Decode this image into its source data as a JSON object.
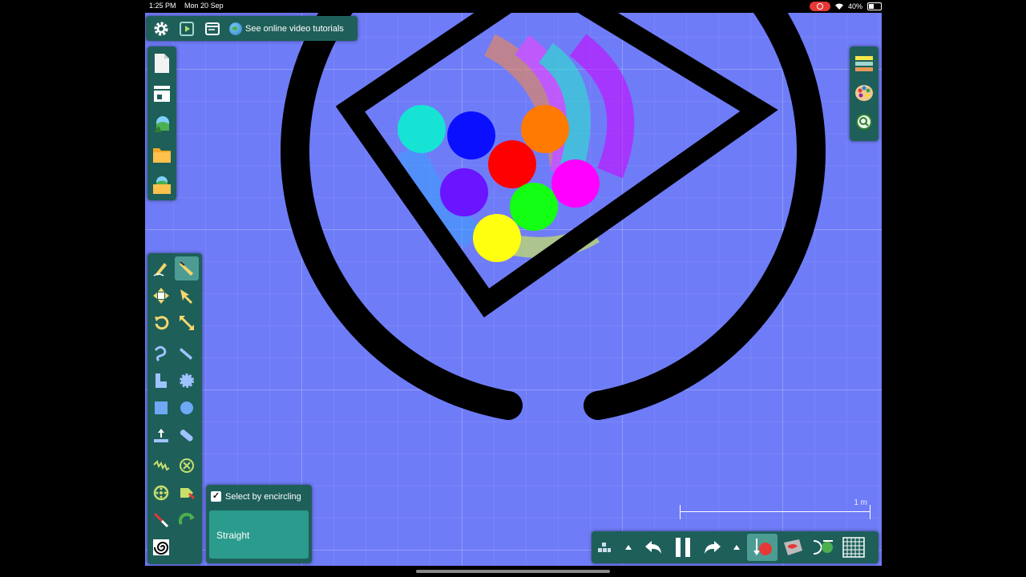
{
  "status_bar": {
    "time": "1:25 PM",
    "date": "Mon 20 Sep",
    "battery": "40%"
  },
  "toolbar": {
    "tutorial_label": "See online video tutorials"
  },
  "selection": {
    "checkbox_label": "Select by encircling",
    "checked": true,
    "mode_label": "Straight"
  },
  "scale": {
    "label": "1 m"
  },
  "colors": {
    "canvas": "#6f7cf7",
    "panel": "#1e5f5a",
    "panel_active": "#4c9c94",
    "ball_cyan": "#16e3d3",
    "ball_blue": "#0a10ff",
    "ball_orange": "#ff7a00",
    "ball_red": "#ff0000",
    "ball_purple": "#6a14ff",
    "ball_magenta": "#ff00ff",
    "ball_green": "#13ff13",
    "ball_yellow": "#ffff10"
  },
  "icons": {
    "topbar": [
      "gear-icon",
      "play-icon",
      "window-icon",
      "globe-icon"
    ],
    "file": [
      "new-file-icon",
      "box-icon",
      "scene-browser-icon",
      "open-folder-icon",
      "scene-folder-icon"
    ],
    "right": [
      "layers-icon",
      "palette-icon",
      "zoom-icon"
    ],
    "tools": [
      "sketch-icon",
      "knife-icon",
      "move-icon",
      "drag-icon",
      "rotate-icon",
      "scale-icon",
      "rope-icon",
      "pen-icon",
      "polygon-icon",
      "gear-shape-icon",
      "box-shape-icon",
      "circle-shape-icon",
      "plane-icon",
      "chain-icon",
      "spring-icon",
      "fixate-icon",
      "axle-icon",
      "tracer-icon",
      "laser-icon",
      "thruster-icon",
      "texture-icon"
    ],
    "bottom": [
      "grid-dots-icon",
      "chevron-up-icon",
      "undo-icon",
      "pause-icon",
      "redo-icon",
      "chevron-up-icon",
      "gravity-icon",
      "air-icon",
      "controller-icon",
      "grid-icon"
    ]
  }
}
